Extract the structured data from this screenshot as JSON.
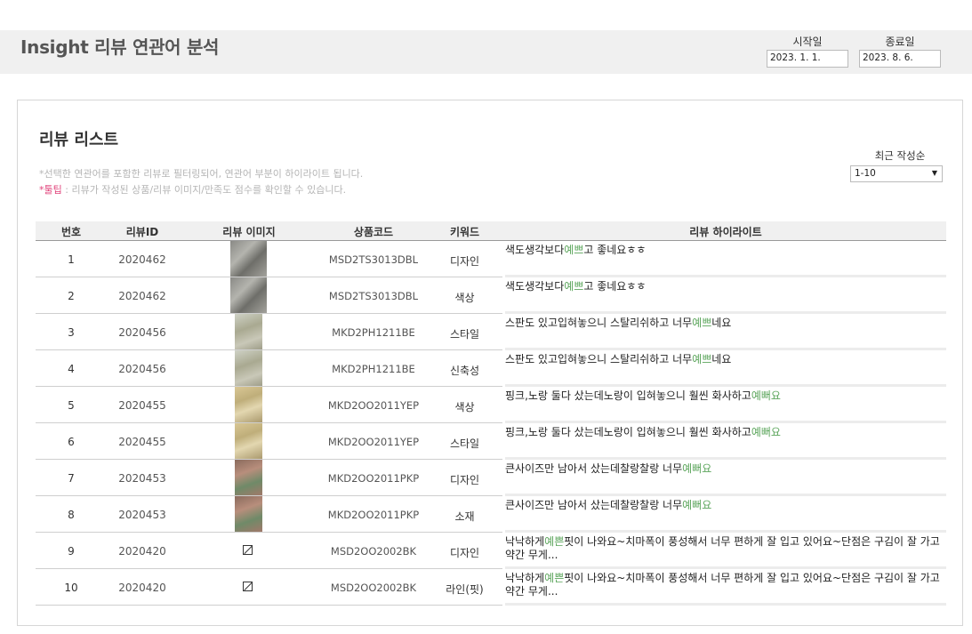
{
  "header": {
    "title": "Insight 리뷰 연관어 분석",
    "start_label": "시작일",
    "start_value": "2023. 1. 1.",
    "end_label": "종료일",
    "end_value": "2023. 8. 6."
  },
  "panel": {
    "title": "리뷰 리스트",
    "note1": "*선택한 연관어를 포함한 리뷰로 필터링되어, 연관어 부분이 하이라이트 됩니다.",
    "note2_prefix": "*",
    "note2_tip": "툴팁",
    "note2_rest": " : 리뷰가 작성된 상품/리뷰 이미지/만족도 점수를 확인할 수 있습니다.",
    "sort_label": "최근 작성순",
    "sort_value": "1-10"
  },
  "table": {
    "headers": {
      "num": "번호",
      "id": "리뷰ID",
      "image": "리뷰 이미지",
      "code": "상품코드",
      "keyword": "키워드",
      "highlight": "리뷰 하이라이트"
    },
    "rows": [
      {
        "num": "1",
        "id": "2020462",
        "image": "thumb-jacket",
        "code": "MSD2TS3013DBL",
        "keyword": "디자인",
        "rev_pre": "색도생각보다",
        "rev_hl": "예쁘",
        "rev_post": "고 좋네요ㅎㅎ"
      },
      {
        "num": "2",
        "id": "2020462",
        "image": "thumb-jacket",
        "code": "MSD2TS3013DBL",
        "keyword": "색상",
        "rev_pre": "색도생각보다",
        "rev_hl": "예쁘",
        "rev_post": "고 좋네요ㅎㅎ"
      },
      {
        "num": "3",
        "id": "2020456",
        "image": "thumb-pants",
        "code": "MKD2PH1211BE",
        "keyword": "스타일",
        "rev_pre": "스판도 있고입혀놓으니 스탈리쉬하고 너무",
        "rev_hl": "예쁘",
        "rev_post": "네요"
      },
      {
        "num": "4",
        "id": "2020456",
        "image": "thumb-pants",
        "code": "MKD2PH1211BE",
        "keyword": "신축성",
        "rev_pre": "스판도 있고입혀놓으니 스탈리쉬하고 너무",
        "rev_hl": "예쁘",
        "rev_post": "네요"
      },
      {
        "num": "5",
        "id": "2020455",
        "image": "thumb-yellow-dress",
        "code": "MKD2OO2011YEP",
        "keyword": "색상",
        "rev_pre": "핑크,노랑 둘다 샀는데노랑이 입혀놓으니 훨씬 화사하고",
        "rev_hl": "예뻐요",
        "rev_post": ""
      },
      {
        "num": "6",
        "id": "2020455",
        "image": "thumb-yellow-dress",
        "code": "MKD2OO2011YEP",
        "keyword": "스타일",
        "rev_pre": "핑크,노랑 둘다 샀는데노랑이 입혀놓으니 훨씬 화사하고",
        "rev_hl": "예뻐요",
        "rev_post": ""
      },
      {
        "num": "7",
        "id": "2020453",
        "image": "thumb-pink-dress",
        "code": "MKD2OO2011PKP",
        "keyword": "디자인",
        "rev_pre": "큰사이즈만 남아서 샀는데찰랑찰랑 너무",
        "rev_hl": "예뻐요",
        "rev_post": ""
      },
      {
        "num": "8",
        "id": "2020453",
        "image": "thumb-pink-dress",
        "code": "MKD2OO2011PKP",
        "keyword": "소재",
        "rev_pre": "큰사이즈만 남아서 샀는데찰랑찰랑 너무",
        "rev_hl": "예뻐요",
        "rev_post": ""
      },
      {
        "num": "9",
        "id": "2020420",
        "image": "broken-image",
        "code": "MSD2OO2002BK",
        "keyword": "디자인",
        "rev_pre": "낙낙하게",
        "rev_hl": "예쁜",
        "rev_post": "핏이 나와요~치마폭이 풍성해서 너무 편하게 잘 입고 있어요~단점은 구김이 잘 가고 약간 무게..."
      },
      {
        "num": "10",
        "id": "2020420",
        "image": "broken-image",
        "code": "MSD2OO2002BK",
        "keyword": "라인(핏)",
        "rev_pre": "낙낙하게",
        "rev_hl": "예쁜",
        "rev_post": "핏이 나와요~치마폭이 풍성해서 너무 편하게 잘 입고 있어요~단점은 구김이 잘 가고 약간 무게..."
      }
    ]
  }
}
